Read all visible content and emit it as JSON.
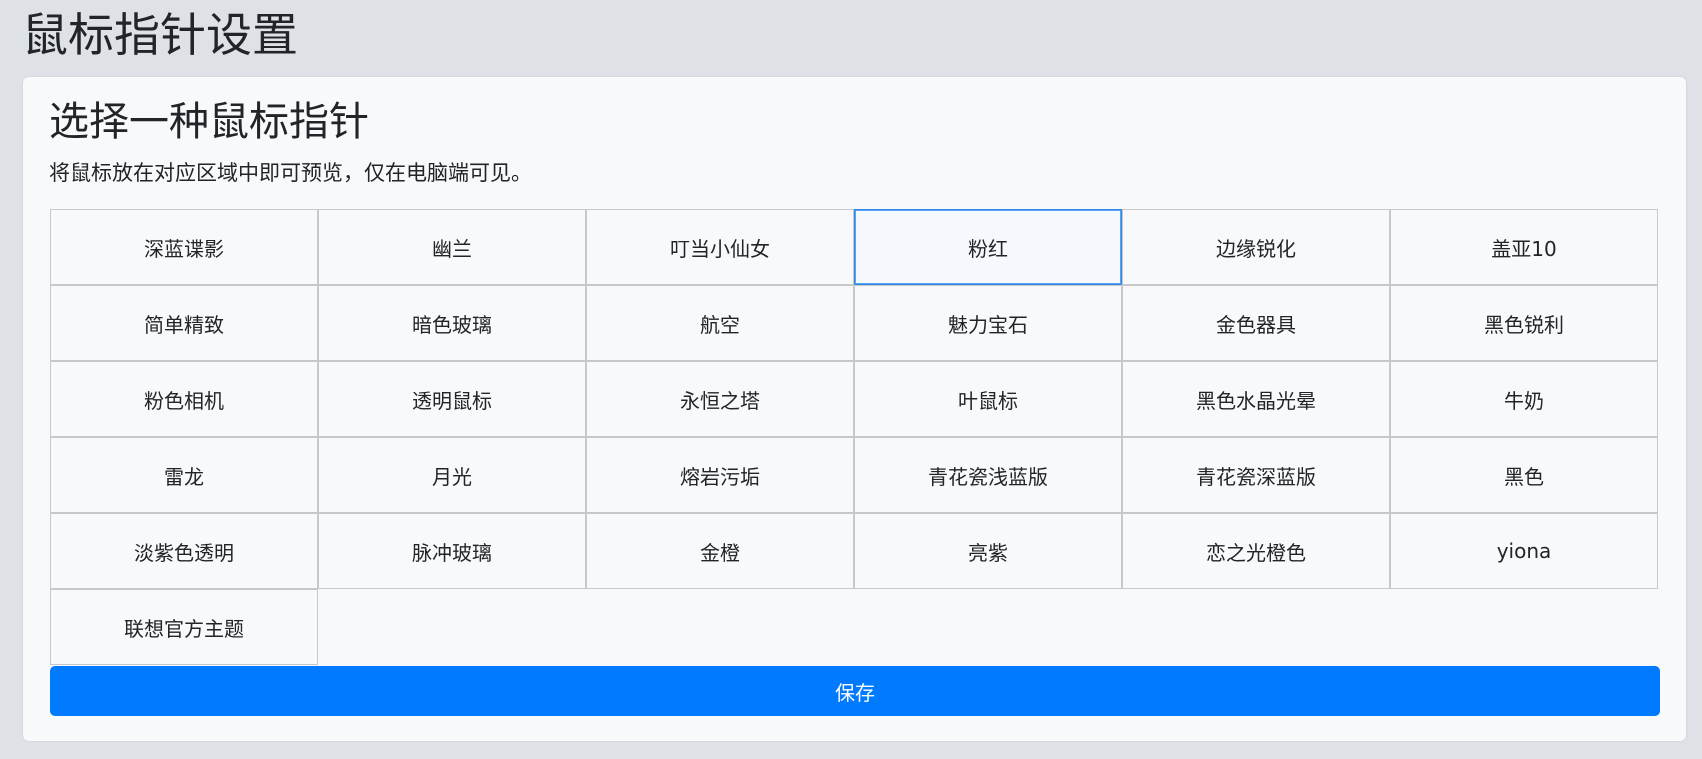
{
  "page": {
    "title": "鼠标指针设置"
  },
  "card": {
    "title": "选择一种鼠标指针",
    "description": "将鼠标放在对应区域中即可预览，仅在电脑端可见。"
  },
  "cursors": {
    "selected": "粉红",
    "items": [
      "深蓝谍影",
      "幽兰",
      "叮当小仙女",
      "粉红",
      "边缘锐化",
      "盖亚10",
      "简单精致",
      "暗色玻璃",
      "航空",
      "魅力宝石",
      "金色器具",
      "黑色锐利",
      "粉色相机",
      "透明鼠标",
      "永恒之塔",
      "叶鼠标",
      "黑色水晶光晕",
      "牛奶",
      "雷龙",
      "月光",
      "熔岩污垢",
      "青花瓷浅蓝版",
      "青花瓷深蓝版",
      "黑色",
      "淡紫色透明",
      "脉冲玻璃",
      "金橙",
      "亮紫",
      "恋之光橙色",
      "yiona",
      "联想官方主题"
    ]
  },
  "actions": {
    "save_label": "保存"
  },
  "colors": {
    "background": "#dee2e6",
    "card_background": "#f8f9fa",
    "accent": "#007bff",
    "selected_border": "#2f86e8"
  }
}
